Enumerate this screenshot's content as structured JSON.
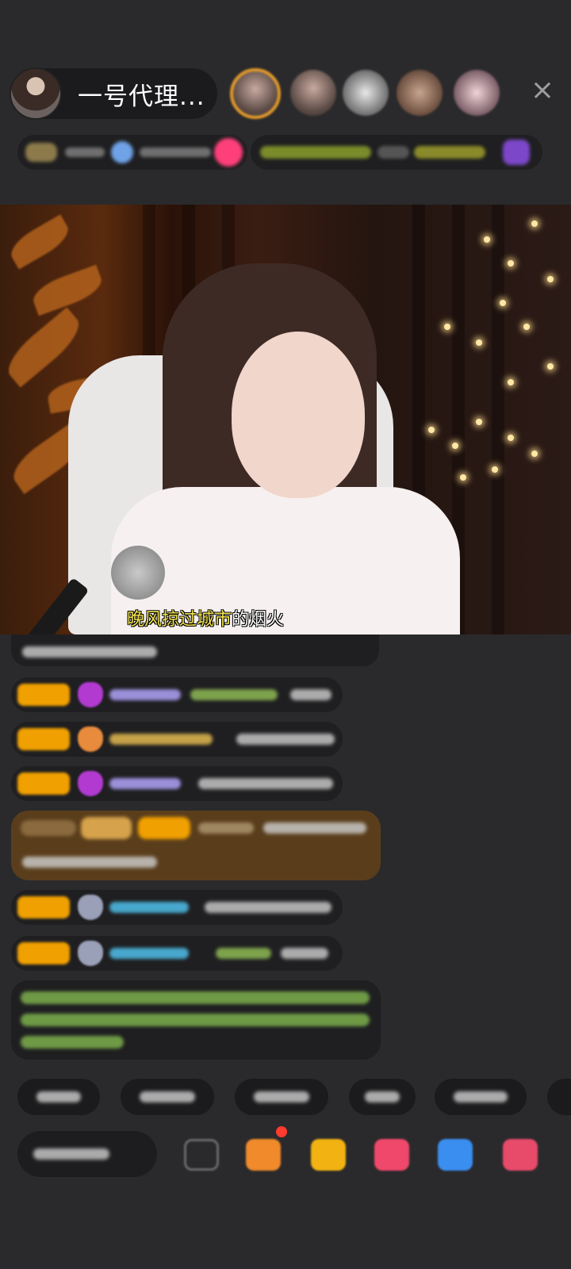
{
  "header": {
    "host_name": "一号代理...",
    "avatar_icon": "host-avatar",
    "close_icon": "×",
    "viewer_count": 5
  },
  "video": {
    "subtitle_highlight": "晚风掠过城市",
    "subtitle_rest": "的烟火"
  },
  "colors": {
    "background": "#2a2a2c",
    "badge": "#f0a000",
    "subtitle": "#f2e34d",
    "panel": "#1f1f21"
  },
  "chat": {
    "message_count": 8,
    "blurred": true
  },
  "quick_replies": {
    "count": 6,
    "blurred": true
  },
  "toolbar": {
    "icons": [
      "emoji-icon",
      "gift-box-icon",
      "gift-bag-icon",
      "heart-gift-icon",
      "game-controller-icon",
      "more-apps-icon"
    ]
  }
}
